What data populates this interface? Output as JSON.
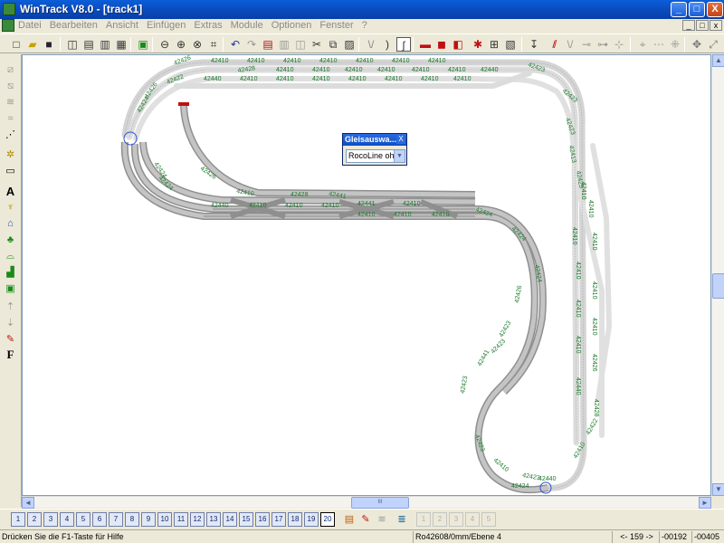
{
  "window": {
    "title": "WinTrack  V8.0 - [track1]",
    "minimize": "_",
    "maximize": "□",
    "close": "X"
  },
  "menu": {
    "items": [
      "Datei",
      "Bearbeiten",
      "Ansicht",
      "Einfügen",
      "Extras",
      "Module",
      "Optionen",
      "Fenster",
      "?"
    ]
  },
  "toolbar": {
    "icons": [
      "new-file-icon",
      "open-folder-icon",
      "save-icon",
      "print-preview-icon",
      "print-icon",
      "page-setup-icon",
      "calculator-icon",
      "picture-icon",
      "zoom-out-icon",
      "zoom-in-icon",
      "zoom-window-icon",
      "zoom-all-icon",
      "undo-icon",
      "redo-icon",
      "doc-red-icon",
      "doc-grid-icon",
      "doc-split-icon",
      "cut-icon",
      "copy-icon",
      "paste-icon",
      "track-straight-icon",
      "track-curve-icon",
      "track-flex-icon",
      "switch-red-icon",
      "switch-red2-icon",
      "switch-red3-icon",
      "crossing-icon",
      "turntable-icon",
      "sections-icon",
      "measure-icon",
      "height-icon",
      "align-icon",
      "connect-icon",
      "disconnect-icon",
      "grid-icon",
      "snap-icon",
      "close-all-icon",
      "info-icon"
    ]
  },
  "left_toolbar": {
    "icons": [
      "track-ladder-icon",
      "track-ladder2-icon",
      "track-parallel-icon",
      "track-parallel2-icon",
      "track-highlight-icon",
      "scenery-icon",
      "layer-icon",
      "text-icon",
      "signal-icon",
      "building-icon",
      "tree-icon",
      "terrain-icon",
      "landscape-icon",
      "contour-icon",
      "height-line-icon",
      "marker-icon",
      "rail-edit-icon",
      "font-icon"
    ],
    "text_icon_label": "A",
    "font_icon_label": "F"
  },
  "canvas": {
    "track_labels": [
      "42426",
      "42410",
      "42410",
      "42410",
      "42410",
      "42410",
      "42410",
      "42410",
      "42423",
      "42428",
      "42410",
      "42410",
      "42410",
      "42410",
      "42410",
      "42410",
      "42440",
      "42440",
      "42422",
      "42410",
      "42410",
      "42410",
      "42410",
      "42410",
      "42410",
      "42410",
      "42424",
      "42426",
      "42424",
      "42424",
      "42426",
      "42410",
      "42428",
      "42441",
      "42441",
      "42410",
      "42440",
      "42410",
      "42410",
      "42410",
      "42410",
      "42410",
      "42410",
      "42424",
      "42424",
      "42424",
      "42426",
      "42423",
      "42423",
      "42441",
      "42423",
      "42423",
      "42410",
      "42423",
      "42424",
      "42440",
      "42423",
      "42423",
      "42413",
      "42425",
      "42410",
      "42410",
      "42410",
      "42410",
      "42410",
      "42410",
      "42410",
      "42410",
      "42410",
      "42426",
      "42440",
      "42428",
      "42422",
      "42410"
    ]
  },
  "dialog": {
    "title": "Gleisauswa...",
    "close": "X",
    "selected_option": "RocoLine ohr"
  },
  "layers": {
    "buttons": [
      "1",
      "2",
      "3",
      "4",
      "5",
      "6",
      "7",
      "8",
      "9",
      "10",
      "11",
      "12",
      "13",
      "14",
      "15",
      "16",
      "17",
      "18",
      "19",
      "20"
    ],
    "active": "20",
    "extra_buttons": [
      "1",
      "2",
      "3",
      "4",
      "5"
    ]
  },
  "scrollbar": {
    "hthumb_grip": "III",
    "up": "▲",
    "down": "▼",
    "left": "◄",
    "right": "►"
  },
  "status": {
    "help": "Drücken Sie die  F1-Taste für Hilfe",
    "track_info": "Ro42608/0mm/Ebene 4",
    "angle": "<- 159 ->",
    "x": "-00192",
    "y": "-00405"
  },
  "colors": {
    "titlebar": "#0b4fc4",
    "track_fill": "#b8b8b8",
    "track_light": "#e4e4e4",
    "label_green": "#1a7a2a",
    "end_marker": "#c01010"
  }
}
